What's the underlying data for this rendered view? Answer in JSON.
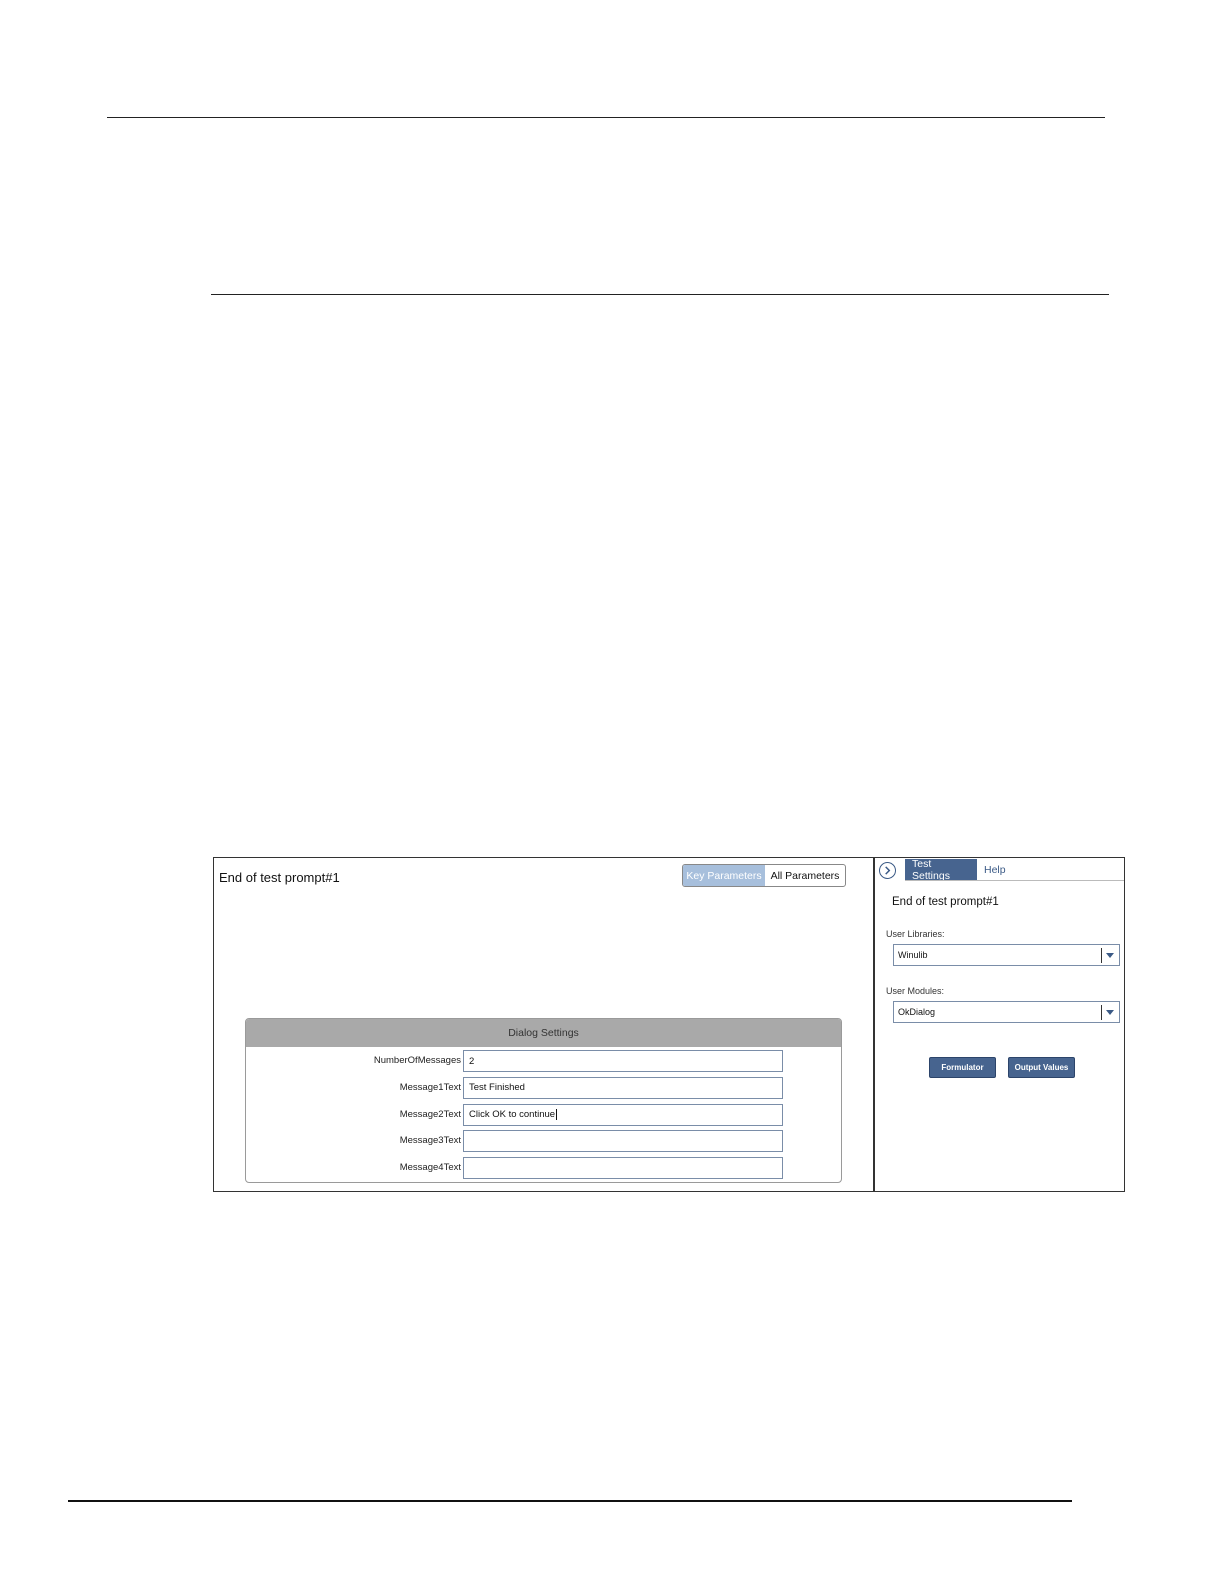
{
  "left_pane": {
    "test_title": "End of test prompt#1",
    "toggle": {
      "key_label": "Key Parameters",
      "all_label": "All Parameters"
    },
    "dialog": {
      "header": "Dialog Settings",
      "rows": [
        {
          "label": "NumberOfMessages",
          "value": "2"
        },
        {
          "label": "Message1Text",
          "value": "Test Finished"
        },
        {
          "label": "Message2Text",
          "value": "Click OK to continue"
        },
        {
          "label": "Message3Text",
          "value": ""
        },
        {
          "label": "Message4Text",
          "value": ""
        }
      ]
    }
  },
  "right_pane": {
    "collapse_icon": "chevron-right-icon",
    "tabs": {
      "test_settings": "Test Settings",
      "help": "Help"
    },
    "title": "End of test prompt#1",
    "user_libraries": {
      "label": "User Libraries:",
      "value": "Winulib"
    },
    "user_modules": {
      "label": "User Modules:",
      "value": "OkDialog"
    },
    "buttons": {
      "formulator": "Formulator",
      "output_values": "Output Values"
    }
  },
  "colors": {
    "accent": "#47648f",
    "toggle_active": "#a7bfdc",
    "header_gray": "#a9a9a9"
  }
}
